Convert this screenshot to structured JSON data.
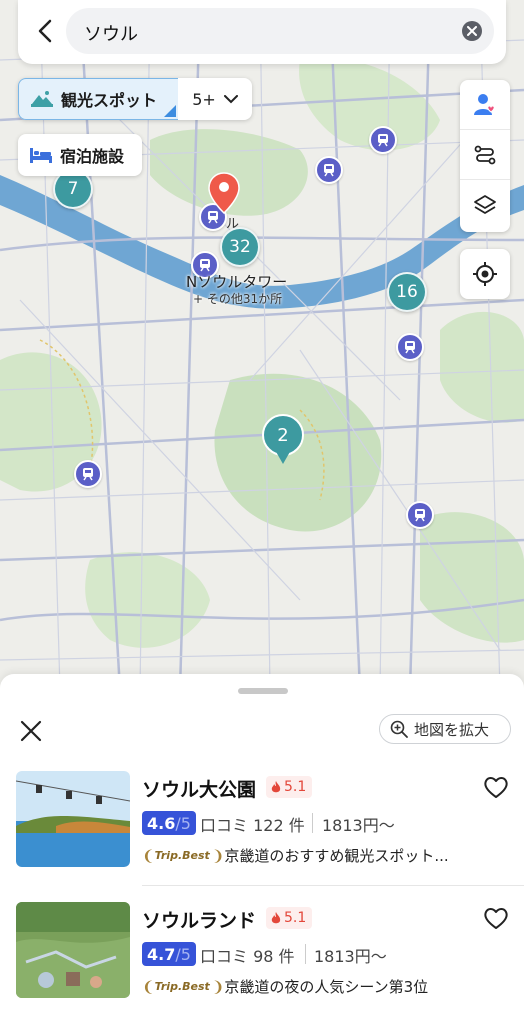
{
  "search": {
    "query": "ソウル"
  },
  "filters": {
    "spots_label": "観光スポット",
    "spots_count": "5+",
    "hotel_label": "宿泊施設"
  },
  "map": {
    "clusters": [
      "7",
      "32",
      "16",
      "2"
    ],
    "label": "Nソウルタワー",
    "sublabel": "+ その他31か所",
    "partial_label": "ル"
  },
  "sheet": {
    "zoom_label": "地図を拡大",
    "results": [
      {
        "title": "ソウル大公園",
        "hot_score": "5.1",
        "rating": "4.6",
        "rating_den": "/5",
        "reviews": "口コミ 122 件",
        "price": "1813円〜",
        "trip_badge": "Trip.Best",
        "highlight": "京畿道のおすすめ観光スポット..."
      },
      {
        "title": "ソウルランド",
        "hot_score": "5.1",
        "rating": "4.7",
        "rating_den": "/5",
        "reviews": "口コミ 98 件",
        "price": "1813円〜",
        "trip_badge": "Trip.Best",
        "highlight": "京畿道の夜の人気シーン第3位"
      }
    ]
  },
  "colors": {
    "cluster": "#3d9aa0",
    "metro": "#5b5fc7",
    "river": "#6fa6d3",
    "rating": "#3653d8",
    "hot": "#e3473a"
  }
}
